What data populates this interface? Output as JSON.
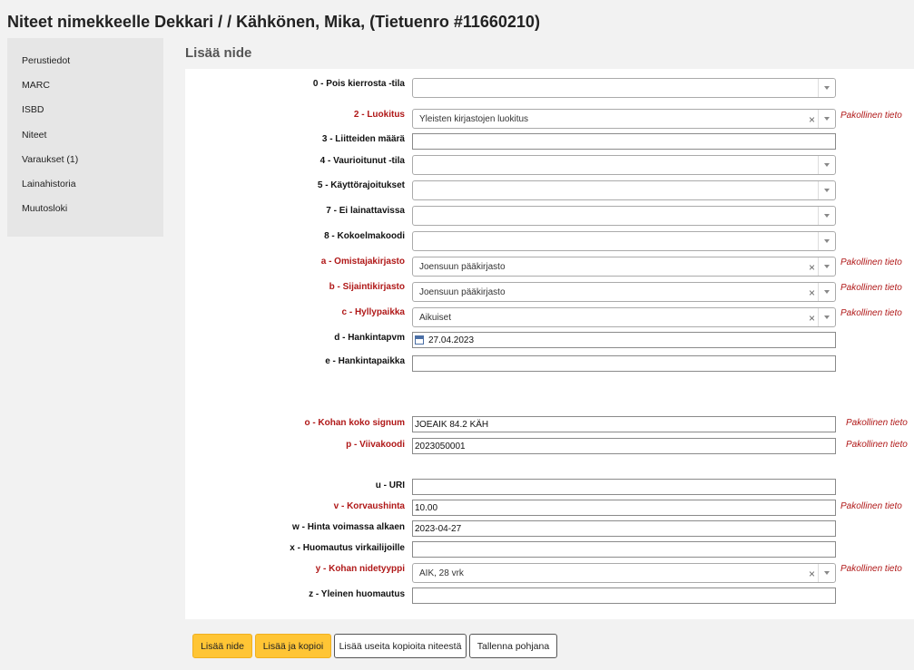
{
  "page_title": "Niteet nimekkeelle Dekkari / / Kähkönen, Mika, (Tietuenro #11660210)",
  "sidebar": {
    "items": [
      {
        "label": "Perustiedot"
      },
      {
        "label": "MARC"
      },
      {
        "label": "ISBD"
      },
      {
        "label": "Niteet"
      },
      {
        "label": "Varaukset (1)"
      },
      {
        "label": "Lainahistoria"
      },
      {
        "label": "Muutosloki"
      }
    ]
  },
  "section_title": "Lisää nide",
  "required_note": "Pakollinen tieto",
  "fields": {
    "f0": {
      "label": "0 - Pois kierrosta -tila",
      "value": ""
    },
    "f2": {
      "label": "2 - Luokitus",
      "value": "Yleisten kirjastojen luokitus"
    },
    "f3": {
      "label": "3 - Liitteiden määrä",
      "value": ""
    },
    "f4": {
      "label": "4 - Vaurioitunut -tila",
      "value": ""
    },
    "f5": {
      "label": "5 - Käyttörajoitukset",
      "value": ""
    },
    "f7": {
      "label": "7 - Ei lainattavissa",
      "value": ""
    },
    "f8": {
      "label": "8 - Kokoelmakoodi",
      "value": ""
    },
    "fa": {
      "label": "a - Omistajakirjasto",
      "value": "Joensuun pääkirjasto"
    },
    "fb": {
      "label": "b - Sijaintikirjasto",
      "value": "Joensuun pääkirjasto"
    },
    "fc": {
      "label": "c - Hyllypaikka",
      "value": "Aikuiset"
    },
    "fd": {
      "label": "d - Hankintapvm",
      "value": "27.04.2023"
    },
    "fe": {
      "label": "e - Hankintapaikka",
      "value": ""
    },
    "fo": {
      "label": "o - Kohan koko signum",
      "value": "JOEAIK 84.2 KÄH"
    },
    "fp": {
      "label": "p - Viivakoodi",
      "value": "2023050001"
    },
    "fu": {
      "label": "u - URI",
      "value": ""
    },
    "fv": {
      "label": "v - Korvaushinta",
      "value": "10.00"
    },
    "fw": {
      "label": "w - Hinta voimassa alkaen",
      "value": "2023-04-27"
    },
    "fx": {
      "label": "x - Huomautus virkailijoille",
      "value": ""
    },
    "fy": {
      "label": "y - Kohan nidetyyppi",
      "value": "AIK, 28 vrk"
    },
    "fz": {
      "label": "z - Yleinen huomautus",
      "value": ""
    }
  },
  "icons": {
    "clear": "×",
    "date": "calendar-icon"
  },
  "buttons": {
    "add": "Lisää nide",
    "add_and_copy": "Lisää ja kopioi",
    "add_multiple": "Lisää useita kopioita niteestä",
    "save_template": "Tallenna pohjana"
  },
  "colors": {
    "accent": "#ffc535",
    "required": "#b01818"
  }
}
